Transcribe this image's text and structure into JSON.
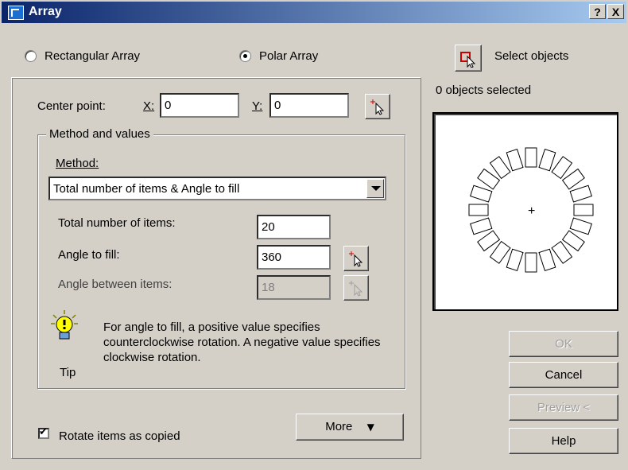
{
  "window": {
    "title": "Array",
    "help_button": "?",
    "close_button": "X"
  },
  "array_type": {
    "rectangular_label": "Rectangular Array",
    "polar_label": "Polar Array",
    "selected": "polar"
  },
  "select_objects": {
    "label": "Select objects",
    "count_text": "0 objects selected"
  },
  "center_point": {
    "label": "Center point:",
    "x_label": "X:",
    "x_value": "0",
    "y_label": "Y:",
    "y_value": "0"
  },
  "method_group": {
    "legend": "Method and values",
    "method_label": "Method:",
    "method_value": "Total number of items & Angle to fill",
    "total_items_label": "Total number of items:",
    "total_items_value": "20",
    "angle_fill_label": "Angle to fill:",
    "angle_fill_value": "360",
    "angle_between_label": "Angle between items:",
    "angle_between_value": "18"
  },
  "tip": {
    "label": "Tip",
    "text": "For angle to fill, a positive value specifies counterclockwise rotation.  A negative value specifies clockwise rotation."
  },
  "rotate_items": {
    "label": "Rotate items as copied",
    "checked": true
  },
  "buttons": {
    "more": "More",
    "ok": "OK",
    "cancel": "Cancel",
    "preview": "Preview <",
    "help": "Help"
  },
  "preview_items_count": 20,
  "colors": {
    "title_start": "#0a246a",
    "title_end": "#a6caf0",
    "face": "#d4d0c8"
  }
}
